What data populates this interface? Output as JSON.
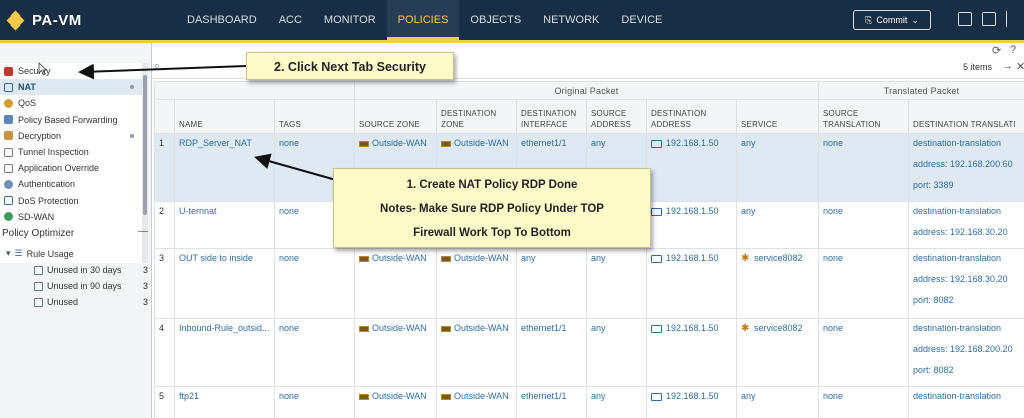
{
  "app": {
    "title": "PA-VM"
  },
  "nav": {
    "tabs": [
      "DASHBOARD",
      "ACC",
      "MONITOR",
      "POLICIES",
      "OBJECTS",
      "NETWORK",
      "DEVICE"
    ],
    "active": "POLICIES"
  },
  "header": {
    "commit_label": "Commit"
  },
  "sidebar": {
    "policies": [
      "Security",
      "NAT",
      "QoS",
      "Policy Based Forwarding",
      "Decryption",
      "Tunnel Inspection",
      "Application Override",
      "Authentication",
      "DoS Protection",
      "SD-WAN"
    ],
    "optimizer_title": "Policy Optimizer",
    "optimizer_collapse": "—",
    "rule_usage": "Rule Usage",
    "usage_items": [
      {
        "label": "Unused in 30 days",
        "count": "3"
      },
      {
        "label": "Unused in 90 days",
        "count": "3"
      },
      {
        "label": "Unused",
        "count": "3"
      }
    ]
  },
  "search": {
    "placeholder": "",
    "items_count": "5 items"
  },
  "table": {
    "group_headers": {
      "original": "Original Packet",
      "translated": "Translated Packet"
    },
    "columns": [
      "",
      "NAME",
      "TAGS",
      "SOURCE ZONE",
      "DESTINATION ZONE",
      "DESTINATION INTERFACE",
      "SOURCE ADDRESS",
      "DESTINATION ADDRESS",
      "SERVICE",
      "SOURCE TRANSLATION",
      "DESTINATION TRANSLATI"
    ],
    "rows": [
      {
        "num": "1",
        "name": "RDP_Server_NAT",
        "tags": "none",
        "src_zone": "Outside-WAN",
        "dst_zone": "Outside-WAN",
        "dst_interface": "ethernet1/1",
        "src_address": "any",
        "dst_address": "192.168.1.50",
        "service": "any",
        "src_translation": "none",
        "dst_translation": [
          "destination-translation",
          "address: 192.168.200.60",
          "port: 3389"
        ]
      },
      {
        "num": "2",
        "name": "U-ternnat",
        "tags": "none",
        "src_zone": "",
        "dst_zone": "",
        "dst_interface": "",
        "src_address": "",
        "dst_address": "192.168.1.50",
        "service": "any",
        "src_translation": "none",
        "dst_translation": [
          "destination-translation",
          "address: 192.168.30.20"
        ]
      },
      {
        "num": "3",
        "name": "OUT side to inside",
        "tags": "none",
        "src_zone": "Outside-WAN",
        "dst_zone": "Outside-WAN",
        "dst_interface": "any",
        "src_address": "any",
        "dst_address": "192.168.1.50",
        "service": "service8082",
        "src_translation": "none",
        "dst_translation": [
          "destination-translation",
          "address: 192.168.30.20",
          "port: 8082"
        ]
      },
      {
        "num": "4",
        "name": "Inbound-Rule_outsid...",
        "tags": "none",
        "src_zone": "Outside-WAN",
        "dst_zone": "Outside-WAN",
        "dst_interface": "ethernet1/1",
        "src_address": "any",
        "dst_address": "192.168.1.50",
        "service": "service8082",
        "src_translation": "none",
        "dst_translation": [
          "destination-translation",
          "address: 192.168.200.20",
          "port: 8082"
        ]
      },
      {
        "num": "5",
        "name": "ftp21",
        "tags": "none",
        "src_zone": "Outside-WAN",
        "dst_zone": "Outside-WAN",
        "dst_interface": "ethernet1/1",
        "src_address": "any",
        "dst_address": "192.168.1.50",
        "service": "any",
        "src_translation": "none",
        "dst_translation": [
          "destination-translation",
          ""
        ]
      }
    ]
  },
  "annotations": {
    "top": "2. Click Next Tab Security",
    "main_lines": [
      "1. Create NAT Policy RDP Done",
      "Notes- Make Sure RDP Policy Under TOP",
      "Firewall Work Top To Bottom"
    ]
  },
  "colors": {
    "nav_bg": "#182e44",
    "accent": "#f7c948",
    "link": "#2f6da4",
    "callout_bg": "#fffcc9",
    "selected_row": "#dfe9f3"
  }
}
